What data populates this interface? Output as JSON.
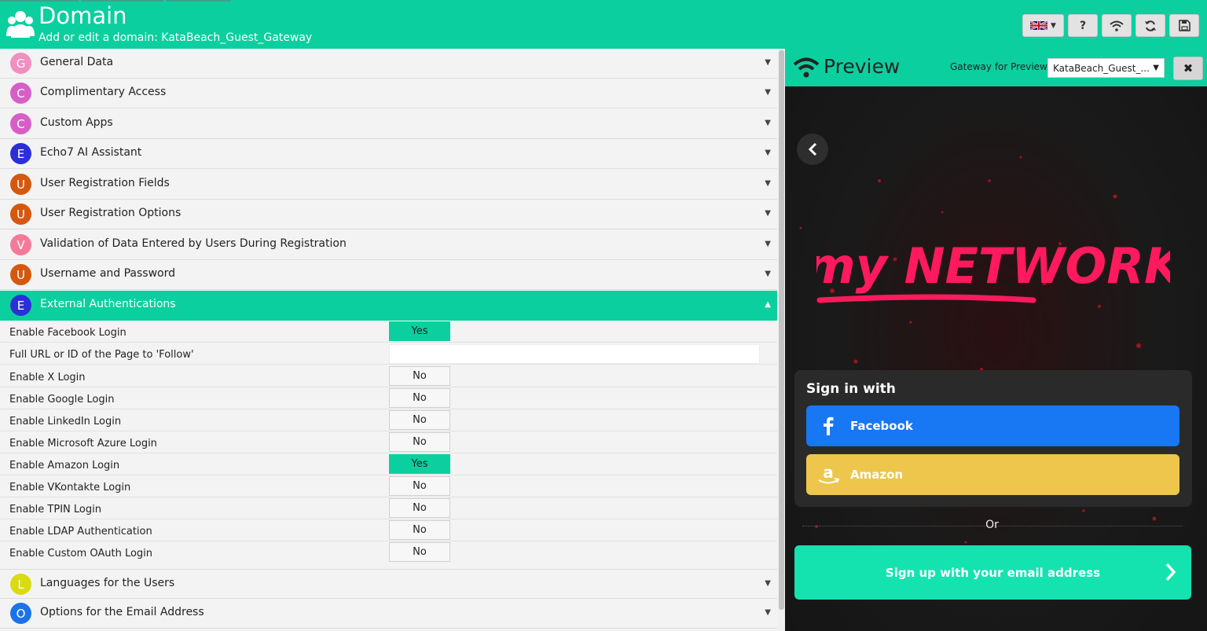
{
  "header": {
    "title": "Domain",
    "subtitle": "Add or edit a domain: KataBeach_Guest_Gateway",
    "icons": [
      "users-icon",
      "uk-flag-icon",
      "chevron-down-icon",
      "help-icon",
      "wifi-icon",
      "refresh-icon",
      "save-icon"
    ],
    "help_label": "?"
  },
  "colors": {
    "accent": "#0ccf9f",
    "facebook": "#1877f2",
    "amazon": "#eec64c",
    "email": "#14e3b0",
    "brand": "#ff1a5e"
  },
  "sections": [
    {
      "letter": "G",
      "label": "General Data",
      "color": "#f08fc0"
    },
    {
      "letter": "C",
      "label": "Complimentary Access",
      "color": "#d65fc7"
    },
    {
      "letter": "C",
      "label": "Custom Apps",
      "color": "#d65fc7"
    },
    {
      "letter": "E",
      "label": "Echo7 AI Assistant",
      "color": "#2c2fd6"
    },
    {
      "letter": "U",
      "label": "User Registration Fields",
      "color": "#d5580e"
    },
    {
      "letter": "U",
      "label": "User Registration Options",
      "color": "#d5580e"
    },
    {
      "letter": "V",
      "label": "Validation of Data Entered by Users During Registration",
      "color": "#f57a9a"
    },
    {
      "letter": "U",
      "label": "Username and Password",
      "color": "#d5580e"
    },
    {
      "letter": "E",
      "label": "External Authentications",
      "color": "#2c2fd6"
    },
    {
      "letter": "L",
      "label": "Languages for the Users",
      "color": "#dada10"
    },
    {
      "letter": "O",
      "label": "Options for the Email Address",
      "color": "#1a74e8"
    }
  ],
  "external_auth": {
    "rows": [
      {
        "label": "Enable Facebook Login",
        "value": "Yes"
      },
      {
        "label": "Full URL or ID of the Page to 'Follow'",
        "value": ""
      },
      {
        "label": "Enable X Login",
        "value": "No"
      },
      {
        "label": "Enable Google Login",
        "value": "No"
      },
      {
        "label": "Enable LinkedIn Login",
        "value": "No"
      },
      {
        "label": "Enable Microsoft Azure Login",
        "value": "No"
      },
      {
        "label": "Enable Amazon Login",
        "value": "Yes"
      },
      {
        "label": "Enable VKontakte Login",
        "value": "No"
      },
      {
        "label": "Enable TPIN Login",
        "value": "No"
      },
      {
        "label": "Enable LDAP Authentication",
        "value": "No"
      },
      {
        "label": "Enable Custom OAuth Login",
        "value": "No"
      }
    ]
  },
  "preview": {
    "title": "Preview",
    "gateway_label": "Gateway for Preview:",
    "gateway_value": "KataBeach_Guest_...",
    "close_label": "✖",
    "brand_text": "my NETWORK",
    "signin_title": "Sign in with",
    "facebook_label": "Facebook",
    "amazon_label": "Amazon",
    "or_text": "Or",
    "email_label": "Sign up with your email address"
  }
}
